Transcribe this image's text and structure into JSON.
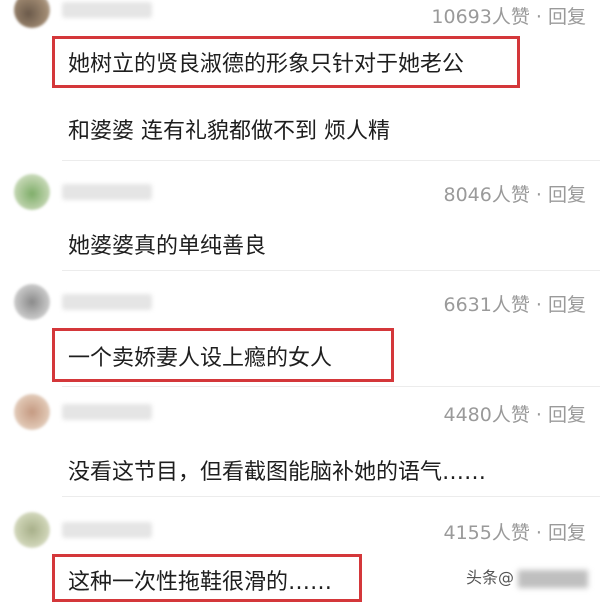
{
  "comments": [
    {
      "likes": "10693人赞",
      "sep": " · ",
      "reply": "回复",
      "lines": [
        "她树立的贤良淑德的形象只针对于她老公",
        "和婆婆 连有礼貌都做不到 烦人精"
      ]
    },
    {
      "likes": "8046人赞",
      "sep": " · ",
      "reply": "回复",
      "lines": [
        "她婆婆真的单纯善良"
      ]
    },
    {
      "likes": "6631人赞",
      "sep": " · ",
      "reply": "回复",
      "lines": [
        "一个卖娇妻人设上瘾的女人"
      ]
    },
    {
      "likes": "4480人赞",
      "sep": " · ",
      "reply": "回复",
      "lines": [
        "没看这节目，但看截图能脑补她的语气……"
      ]
    },
    {
      "likes": "4155人赞",
      "sep": " · ",
      "reply": "回复",
      "lines": [
        "这种一次性拖鞋很滑的……"
      ]
    }
  ],
  "watermark": {
    "prefix": "头条@"
  },
  "colors": {
    "highlight": "#d4373a",
    "meta": "#9a9a9a",
    "text": "#1e1e1e"
  }
}
